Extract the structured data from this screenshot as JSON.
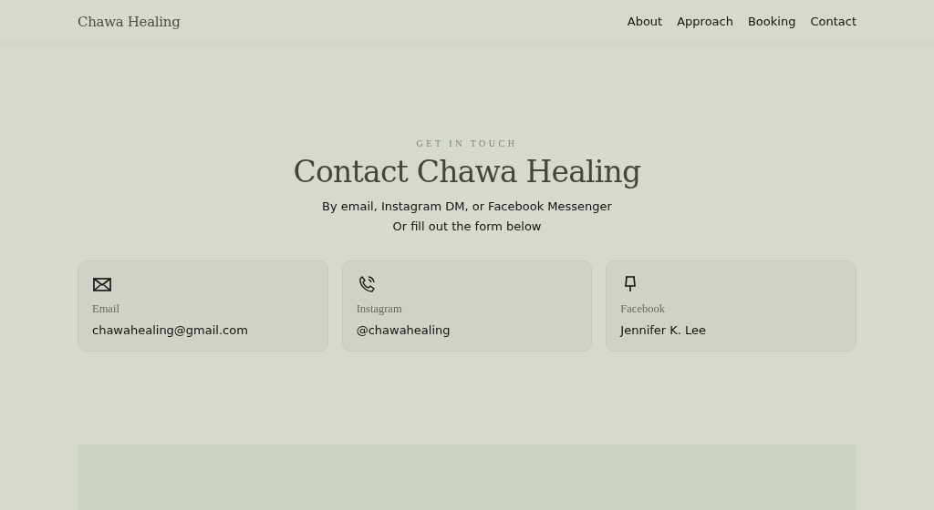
{
  "header": {
    "logo": "Chawa Healing",
    "nav": [
      {
        "label": "About"
      },
      {
        "label": "Approach"
      },
      {
        "label": "Booking"
      },
      {
        "label": "Contact"
      }
    ]
  },
  "hero": {
    "eyebrow": "GET IN TOUCH",
    "title": "Contact Chawa Healing",
    "lines": [
      "By email, Instagram DM, or Facebook Messenger",
      "Or fill out the form below"
    ]
  },
  "cards": [
    {
      "kind": "envelope",
      "label": "Email",
      "value": "chawahealing@gmail.com"
    },
    {
      "kind": "phone",
      "label": "Instagram",
      "value": "@chawahealing"
    },
    {
      "kind": "pin",
      "label": "Facebook",
      "value": "Jennifer K. Lee"
    }
  ]
}
